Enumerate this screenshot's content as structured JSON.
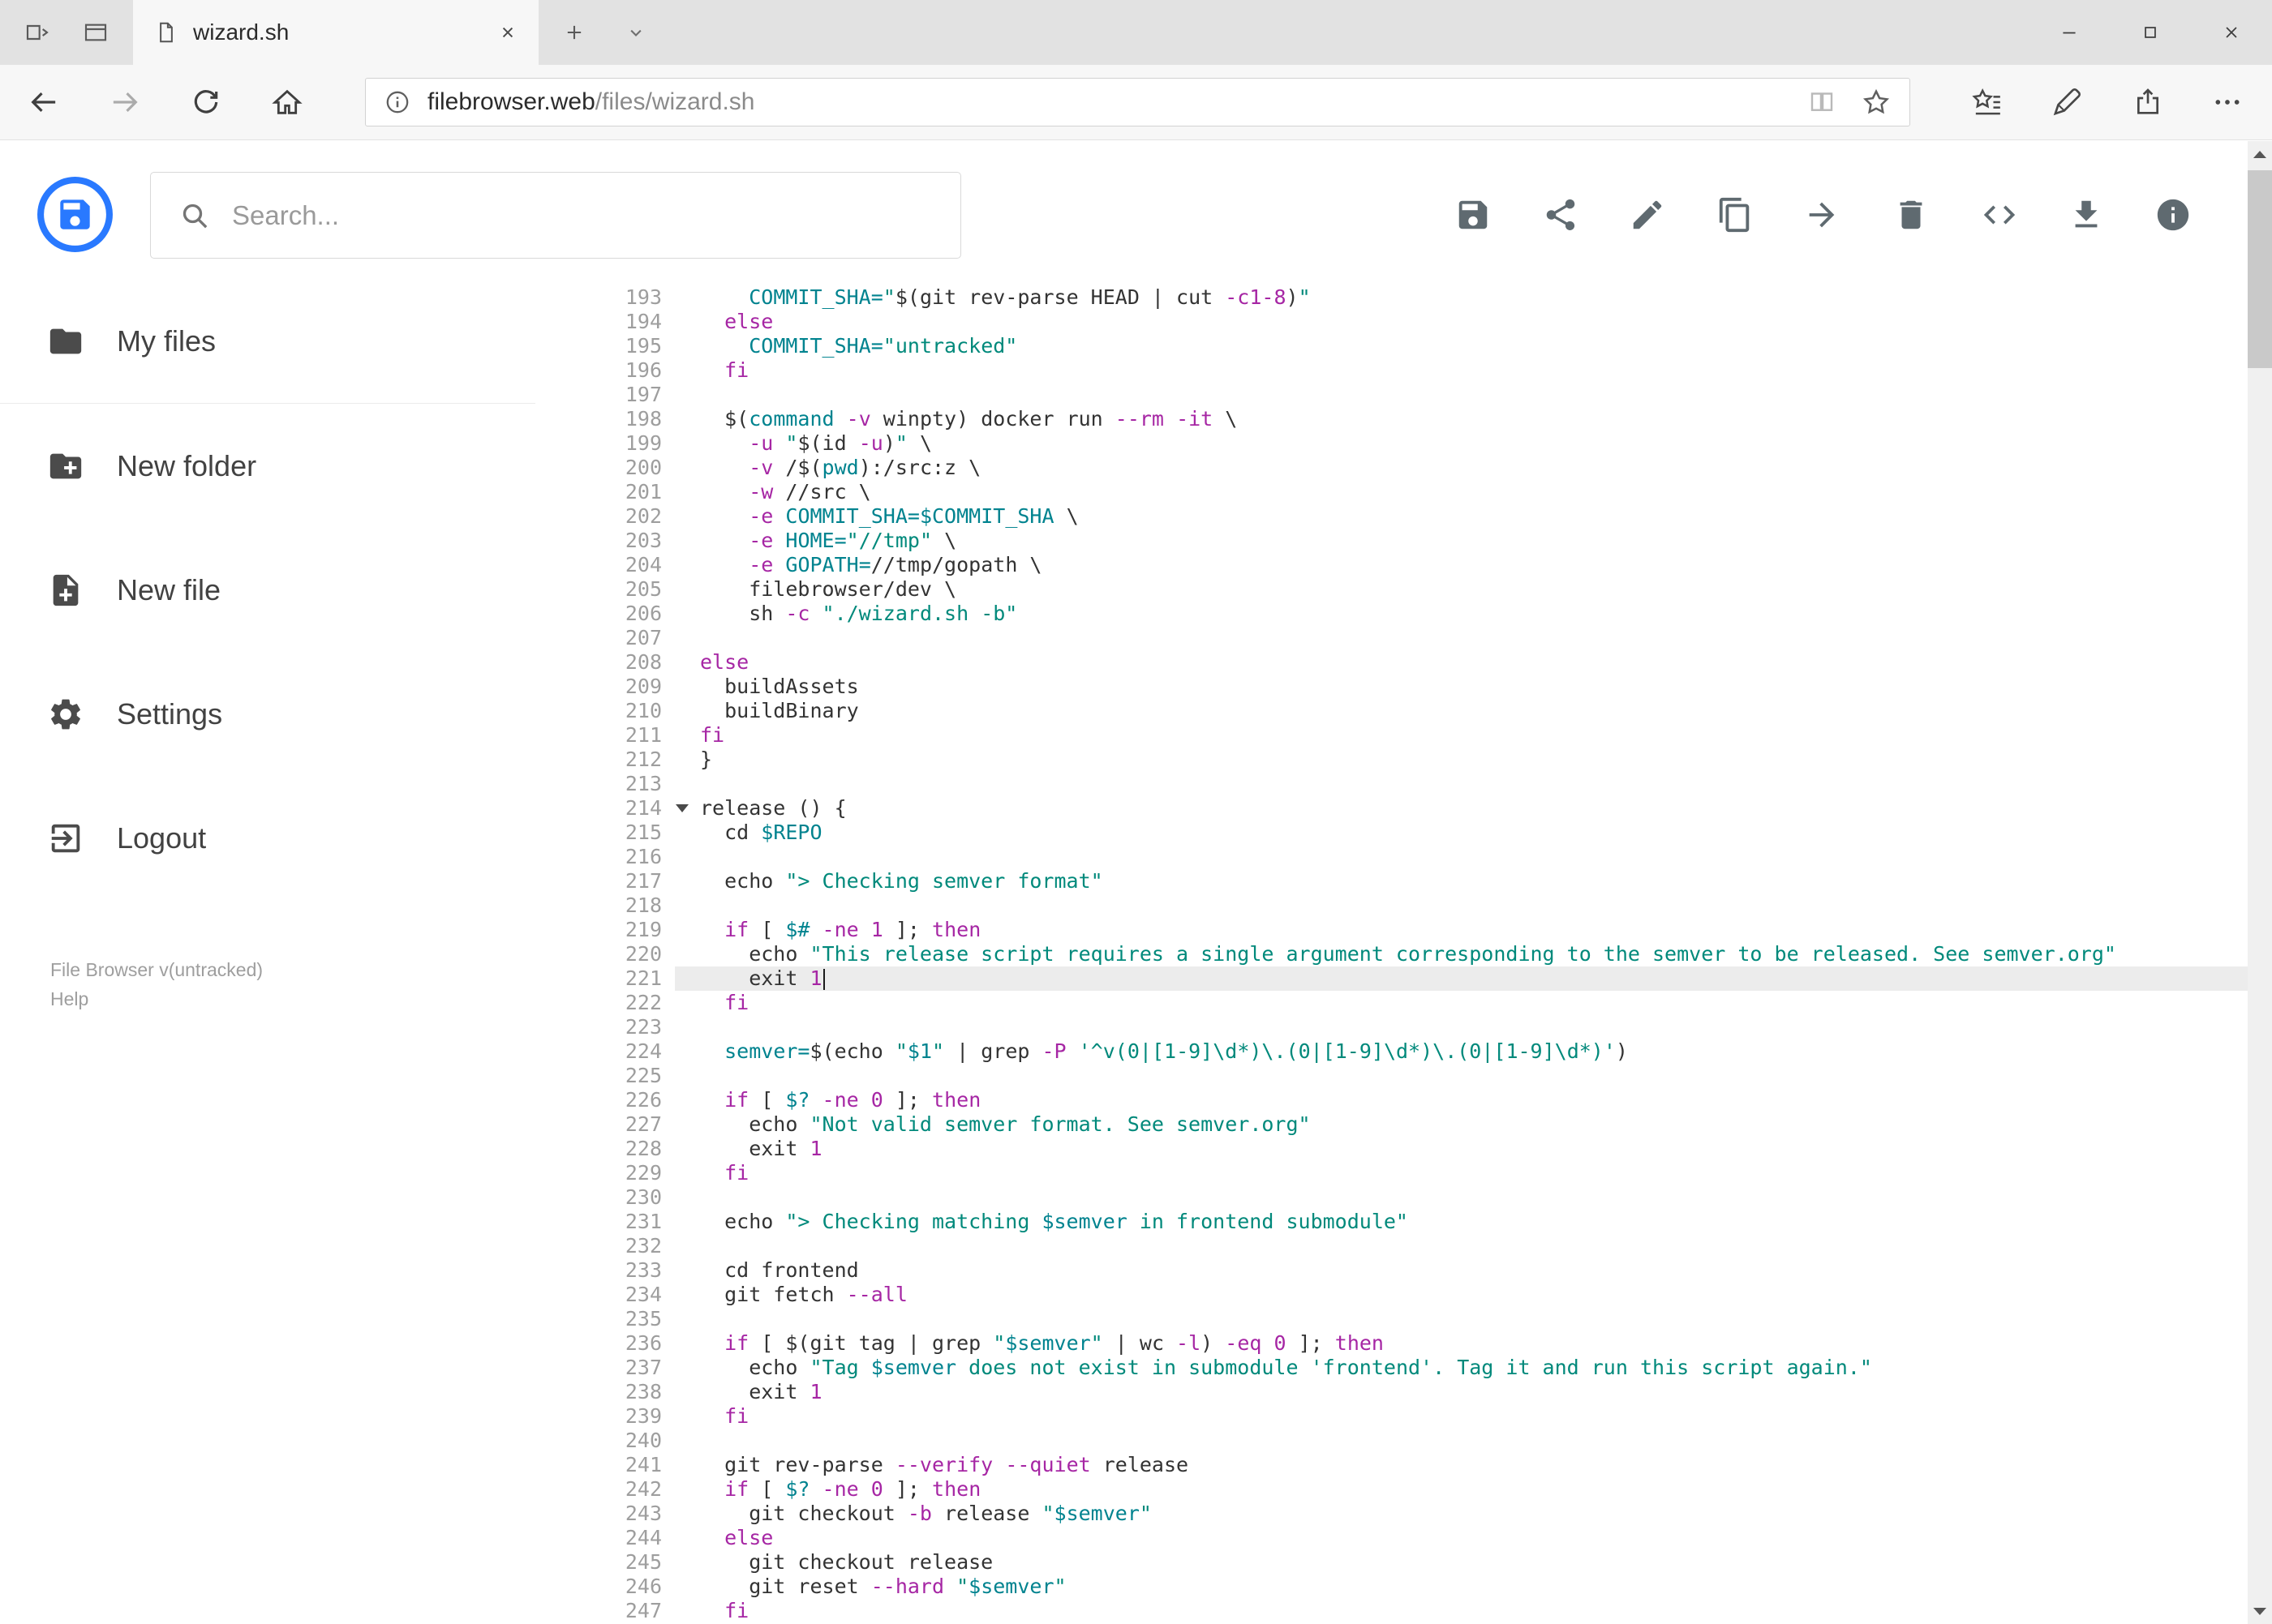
{
  "window": {
    "tab_title": "wizard.sh"
  },
  "navbar": {
    "url_host": "filebrowser.web",
    "url_path": "/files/wizard.sh"
  },
  "app": {
    "search_placeholder": "Search...",
    "toolbar_icons": [
      "save",
      "share",
      "rename",
      "copy",
      "move",
      "delete",
      "code-view",
      "download",
      "info"
    ],
    "sidebar": {
      "items": [
        {
          "icon": "folder",
          "label": "My files"
        },
        {
          "icon": "new-folder",
          "label": "New folder"
        },
        {
          "icon": "new-file",
          "label": "New file"
        },
        {
          "icon": "settings",
          "label": "Settings"
        },
        {
          "icon": "logout",
          "label": "Logout"
        }
      ],
      "footer_version": "File Browser v(untracked)",
      "footer_help": "Help"
    }
  },
  "editor": {
    "active_line": 221,
    "folded_marker_line": 214,
    "lines": [
      {
        "n": 193,
        "t": [
          [
            "d",
            "    "
          ],
          [
            "v",
            "COMMIT_SHA="
          ],
          [
            "s",
            "\""
          ],
          [
            "d",
            "$(git rev-parse HEAD | cut "
          ],
          [
            "k",
            "-c1-8"
          ],
          [
            "d",
            ")"
          ],
          [
            "s",
            "\""
          ]
        ]
      },
      {
        "n": 194,
        "t": [
          [
            "d",
            "  "
          ],
          [
            "k",
            "else"
          ]
        ]
      },
      {
        "n": 195,
        "t": [
          [
            "d",
            "    "
          ],
          [
            "v",
            "COMMIT_SHA="
          ],
          [
            "s",
            "\"untracked\""
          ]
        ]
      },
      {
        "n": 196,
        "t": [
          [
            "d",
            "  "
          ],
          [
            "k",
            "fi"
          ]
        ]
      },
      {
        "n": 197,
        "t": []
      },
      {
        "n": 198,
        "t": [
          [
            "d",
            "  $("
          ],
          [
            "v",
            "command"
          ],
          [
            "d",
            " "
          ],
          [
            "k",
            "-v"
          ],
          [
            "d",
            " winpty) docker run "
          ],
          [
            "k",
            "--rm"
          ],
          [
            "d",
            " "
          ],
          [
            "k",
            "-it"
          ],
          [
            "d",
            " \\"
          ]
        ]
      },
      {
        "n": 199,
        "t": [
          [
            "d",
            "    "
          ],
          [
            "k",
            "-u"
          ],
          [
            "d",
            " "
          ],
          [
            "s",
            "\""
          ],
          [
            "d",
            "$(id "
          ],
          [
            "k",
            "-u"
          ],
          [
            "d",
            ")"
          ],
          [
            "s",
            "\""
          ],
          [
            "d",
            " \\"
          ]
        ]
      },
      {
        "n": 200,
        "t": [
          [
            "d",
            "    "
          ],
          [
            "k",
            "-v"
          ],
          [
            "d",
            " /$("
          ],
          [
            "v",
            "pwd"
          ],
          [
            "d",
            "):/src:z \\"
          ]
        ]
      },
      {
        "n": 201,
        "t": [
          [
            "d",
            "    "
          ],
          [
            "k",
            "-w"
          ],
          [
            "d",
            " //src \\"
          ]
        ]
      },
      {
        "n": 202,
        "t": [
          [
            "d",
            "    "
          ],
          [
            "k",
            "-e"
          ],
          [
            "d",
            " "
          ],
          [
            "v",
            "COMMIT_SHA=$COMMIT_SHA"
          ],
          [
            "d",
            " \\"
          ]
        ]
      },
      {
        "n": 203,
        "t": [
          [
            "d",
            "    "
          ],
          [
            "k",
            "-e"
          ],
          [
            "d",
            " "
          ],
          [
            "v",
            "HOME="
          ],
          [
            "s",
            "\"//tmp\""
          ],
          [
            "d",
            " \\"
          ]
        ]
      },
      {
        "n": 204,
        "t": [
          [
            "d",
            "    "
          ],
          [
            "k",
            "-e"
          ],
          [
            "d",
            " "
          ],
          [
            "v",
            "GOPATH="
          ],
          [
            "d",
            "//tmp/gopath \\"
          ]
        ]
      },
      {
        "n": 205,
        "t": [
          [
            "d",
            "    filebrowser/dev \\"
          ]
        ]
      },
      {
        "n": 206,
        "t": [
          [
            "d",
            "    sh "
          ],
          [
            "k",
            "-c"
          ],
          [
            "d",
            " "
          ],
          [
            "s",
            "\"./wizard.sh -b\""
          ]
        ]
      },
      {
        "n": 207,
        "t": []
      },
      {
        "n": 208,
        "t": [
          [
            "k",
            "else"
          ]
        ]
      },
      {
        "n": 209,
        "t": [
          [
            "d",
            "  buildAssets"
          ]
        ]
      },
      {
        "n": 210,
        "t": [
          [
            "d",
            "  buildBinary"
          ]
        ]
      },
      {
        "n": 211,
        "t": [
          [
            "k",
            "fi"
          ]
        ]
      },
      {
        "n": 212,
        "t": [
          [
            "d",
            "}"
          ]
        ]
      },
      {
        "n": 213,
        "t": []
      },
      {
        "n": 214,
        "t": [
          [
            "d",
            "release () {"
          ]
        ]
      },
      {
        "n": 215,
        "t": [
          [
            "d",
            "  cd "
          ],
          [
            "v",
            "$REPO"
          ]
        ]
      },
      {
        "n": 216,
        "t": []
      },
      {
        "n": 217,
        "t": [
          [
            "d",
            "  echo "
          ],
          [
            "s",
            "\"> Checking semver format\""
          ]
        ]
      },
      {
        "n": 218,
        "t": []
      },
      {
        "n": 219,
        "t": [
          [
            "d",
            "  "
          ],
          [
            "k",
            "if"
          ],
          [
            "d",
            " [ "
          ],
          [
            "v",
            "$#"
          ],
          [
            "d",
            " "
          ],
          [
            "k",
            "-ne"
          ],
          [
            "d",
            " "
          ],
          [
            "k",
            "1"
          ],
          [
            "d",
            " ]; "
          ],
          [
            "k",
            "then"
          ]
        ]
      },
      {
        "n": 220,
        "t": [
          [
            "d",
            "    echo "
          ],
          [
            "s",
            "\"This release script requires a single argument corresponding to the semver to be released. See semver.org\""
          ]
        ]
      },
      {
        "n": 221,
        "t": [
          [
            "d",
            "    exit "
          ],
          [
            "k",
            "1"
          ]
        ]
      },
      {
        "n": 222,
        "t": [
          [
            "d",
            "  "
          ],
          [
            "k",
            "fi"
          ]
        ]
      },
      {
        "n": 223,
        "t": []
      },
      {
        "n": 224,
        "t": [
          [
            "d",
            "  "
          ],
          [
            "v",
            "semver="
          ],
          [
            "d",
            "$(echo "
          ],
          [
            "s",
            "\""
          ],
          [
            "v",
            "$1"
          ],
          [
            "s",
            "\""
          ],
          [
            "d",
            " | grep "
          ],
          [
            "k",
            "-P"
          ],
          [
            "d",
            " "
          ],
          [
            "s",
            "'^v(0|[1-9]\\d*)\\.(0|[1-9]\\d*)\\.(0|[1-9]\\d*)'"
          ],
          [
            "d",
            ")"
          ]
        ]
      },
      {
        "n": 225,
        "t": []
      },
      {
        "n": 226,
        "t": [
          [
            "d",
            "  "
          ],
          [
            "k",
            "if"
          ],
          [
            "d",
            " [ "
          ],
          [
            "v",
            "$?"
          ],
          [
            "d",
            " "
          ],
          [
            "k",
            "-ne"
          ],
          [
            "d",
            " "
          ],
          [
            "k",
            "0"
          ],
          [
            "d",
            " ]; "
          ],
          [
            "k",
            "then"
          ]
        ]
      },
      {
        "n": 227,
        "t": [
          [
            "d",
            "    echo "
          ],
          [
            "s",
            "\"Not valid semver format. See semver.org\""
          ]
        ]
      },
      {
        "n": 228,
        "t": [
          [
            "d",
            "    exit "
          ],
          [
            "k",
            "1"
          ]
        ]
      },
      {
        "n": 229,
        "t": [
          [
            "d",
            "  "
          ],
          [
            "k",
            "fi"
          ]
        ]
      },
      {
        "n": 230,
        "t": []
      },
      {
        "n": 231,
        "t": [
          [
            "d",
            "  echo "
          ],
          [
            "s",
            "\"> Checking matching "
          ],
          [
            "v",
            "$semver"
          ],
          [
            "s",
            " in frontend submodule\""
          ]
        ]
      },
      {
        "n": 232,
        "t": []
      },
      {
        "n": 233,
        "t": [
          [
            "d",
            "  cd frontend"
          ]
        ]
      },
      {
        "n": 234,
        "t": [
          [
            "d",
            "  git fetch "
          ],
          [
            "k",
            "--all"
          ]
        ]
      },
      {
        "n": 235,
        "t": []
      },
      {
        "n": 236,
        "t": [
          [
            "d",
            "  "
          ],
          [
            "k",
            "if"
          ],
          [
            "d",
            " [ $(git tag | grep "
          ],
          [
            "s",
            "\""
          ],
          [
            "v",
            "$semver"
          ],
          [
            "s",
            "\""
          ],
          [
            "d",
            " | wc "
          ],
          [
            "k",
            "-l"
          ],
          [
            "d",
            ") "
          ],
          [
            "k",
            "-eq"
          ],
          [
            "d",
            " "
          ],
          [
            "k",
            "0"
          ],
          [
            "d",
            " ]; "
          ],
          [
            "k",
            "then"
          ]
        ]
      },
      {
        "n": 237,
        "t": [
          [
            "d",
            "    echo "
          ],
          [
            "s",
            "\"Tag "
          ],
          [
            "v",
            "$semver"
          ],
          [
            "s",
            " does not exist in submodule 'frontend'. Tag it and run this script again.\""
          ]
        ]
      },
      {
        "n": 238,
        "t": [
          [
            "d",
            "    exit "
          ],
          [
            "k",
            "1"
          ]
        ]
      },
      {
        "n": 239,
        "t": [
          [
            "d",
            "  "
          ],
          [
            "k",
            "fi"
          ]
        ]
      },
      {
        "n": 240,
        "t": []
      },
      {
        "n": 241,
        "t": [
          [
            "d",
            "  git rev-parse "
          ],
          [
            "k",
            "--verify"
          ],
          [
            "d",
            " "
          ],
          [
            "k",
            "--quiet"
          ],
          [
            "d",
            " release"
          ]
        ]
      },
      {
        "n": 242,
        "t": [
          [
            "d",
            "  "
          ],
          [
            "k",
            "if"
          ],
          [
            "d",
            " [ "
          ],
          [
            "v",
            "$?"
          ],
          [
            "d",
            " "
          ],
          [
            "k",
            "-ne"
          ],
          [
            "d",
            " "
          ],
          [
            "k",
            "0"
          ],
          [
            "d",
            " ]; "
          ],
          [
            "k",
            "then"
          ]
        ]
      },
      {
        "n": 243,
        "t": [
          [
            "d",
            "    git checkout "
          ],
          [
            "k",
            "-b"
          ],
          [
            "d",
            " release "
          ],
          [
            "s",
            "\""
          ],
          [
            "v",
            "$semver"
          ],
          [
            "s",
            "\""
          ]
        ]
      },
      {
        "n": 244,
        "t": [
          [
            "d",
            "  "
          ],
          [
            "k",
            "else"
          ]
        ]
      },
      {
        "n": 245,
        "t": [
          [
            "d",
            "    git checkout release"
          ]
        ]
      },
      {
        "n": 246,
        "t": [
          [
            "d",
            "    git reset "
          ],
          [
            "k",
            "--hard"
          ],
          [
            "d",
            " "
          ],
          [
            "s",
            "\""
          ],
          [
            "v",
            "$semver"
          ],
          [
            "s",
            "\""
          ]
        ]
      },
      {
        "n": 247,
        "t": [
          [
            "d",
            "  "
          ],
          [
            "k",
            "fi"
          ]
        ]
      }
    ]
  },
  "colors": {
    "accent_blue": "#2979ff",
    "icon_gray": "#5f6a70",
    "keyword": "#a626a4",
    "string": "#00897b",
    "variable": "#00838f",
    "active_line_bg": "#ececec"
  }
}
